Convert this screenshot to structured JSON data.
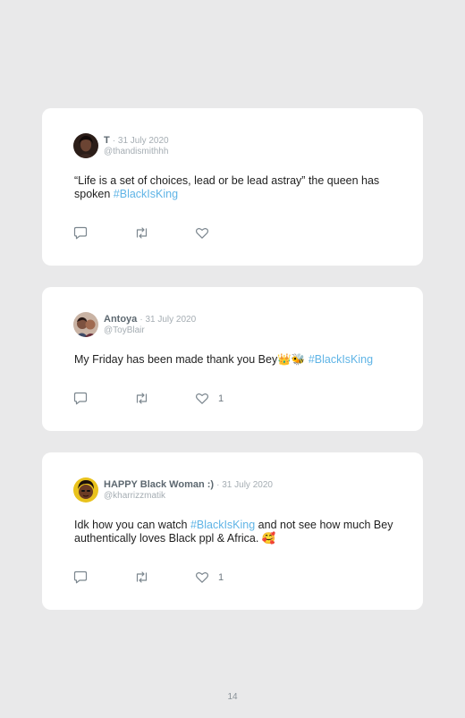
{
  "tweets": [
    {
      "name": "T",
      "date": "· 31 July 2020",
      "handle": "@thandismithhh",
      "text_before": "“Life is a set of choices, lead or be lead astray” the queen has spoken ",
      "hashtag": "#BlackIsKing",
      "text_after": "",
      "likes": ""
    },
    {
      "name": "Antoya",
      "date": "· 31 July 2020",
      "handle": "@ToyBlair",
      "text_before": "My Friday has been made thank you Bey👑🐝 ",
      "hashtag": "#BlackIsKing",
      "text_after": "",
      "likes": "1"
    },
    {
      "name": "HAPPY Black Woman :)",
      "date": "· 31 July 2020",
      "handle": "@kharrizzmatik",
      "text_before": "Idk how you can watch ",
      "hashtag": "#BlackIsKing",
      "text_after": " and not see how much Bey authentically loves Black ppl & Africa. 🥰",
      "likes": "1"
    }
  ],
  "page_number": "14",
  "colors": {
    "background": "#e9e9ea",
    "card": "#ffffff",
    "hashtag": "#5fb4e6",
    "icon": "#7b868e"
  },
  "icons": [
    "reply-icon",
    "retweet-icon",
    "heart-icon"
  ]
}
